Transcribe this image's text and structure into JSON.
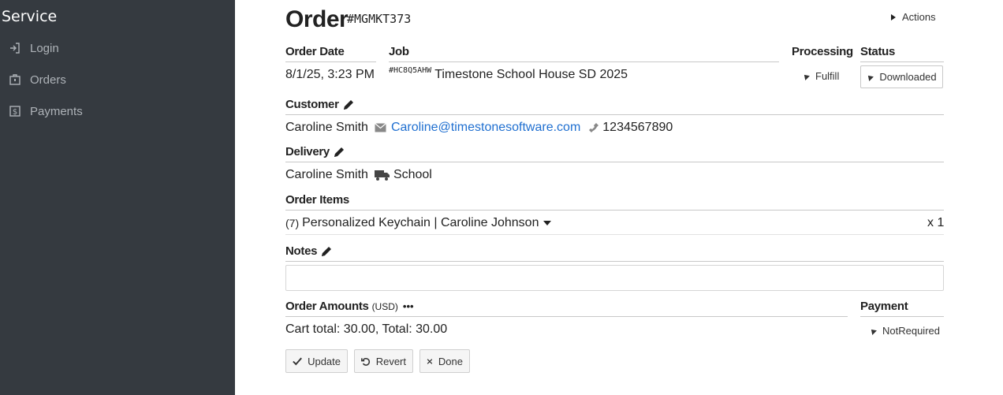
{
  "sidebar": {
    "title": "Service",
    "items": [
      {
        "label": "Login",
        "icon": "sign-in-icon"
      },
      {
        "label": "Orders",
        "icon": "briefcase-icon"
      },
      {
        "label": "Payments",
        "icon": "dollar-icon"
      }
    ]
  },
  "order": {
    "title": "Order",
    "code": "#MGMKT373",
    "actions_label": "Actions"
  },
  "headers": {
    "order_date": "Order Date",
    "job": "Job",
    "processing": "Processing",
    "status": "Status",
    "customer": "Customer",
    "delivery": "Delivery",
    "order_items": "Order Items",
    "notes": "Notes",
    "order_amounts": "Order Amounts",
    "currency": "(USD)",
    "payment": "Payment"
  },
  "values": {
    "order_date": "8/1/25, 3:23 PM",
    "job_tag": "#HC8Q5AHW",
    "job_name": "Timestone School House SD 2025",
    "processing": "Fulfill",
    "status": "Downloaded",
    "customer_name": "Caroline Smith",
    "customer_email": "Caroline@timestonesoftware.com",
    "customer_phone": "1234567890",
    "delivery_name": "Caroline Smith",
    "delivery_method": "School",
    "item_index": "(7)",
    "item_label": "Personalized Keychain | Caroline Johnson",
    "item_qty": "x 1",
    "amounts_text": "Cart total: 30.00,  Total: 30.00",
    "payment_status": "NotRequired",
    "more_dots": "•••"
  },
  "buttons": {
    "update": "Update",
    "revert": "Revert",
    "done": "Done"
  },
  "colors": {
    "sidebar_bg": "#353a40",
    "link": "#1f6fd0"
  }
}
